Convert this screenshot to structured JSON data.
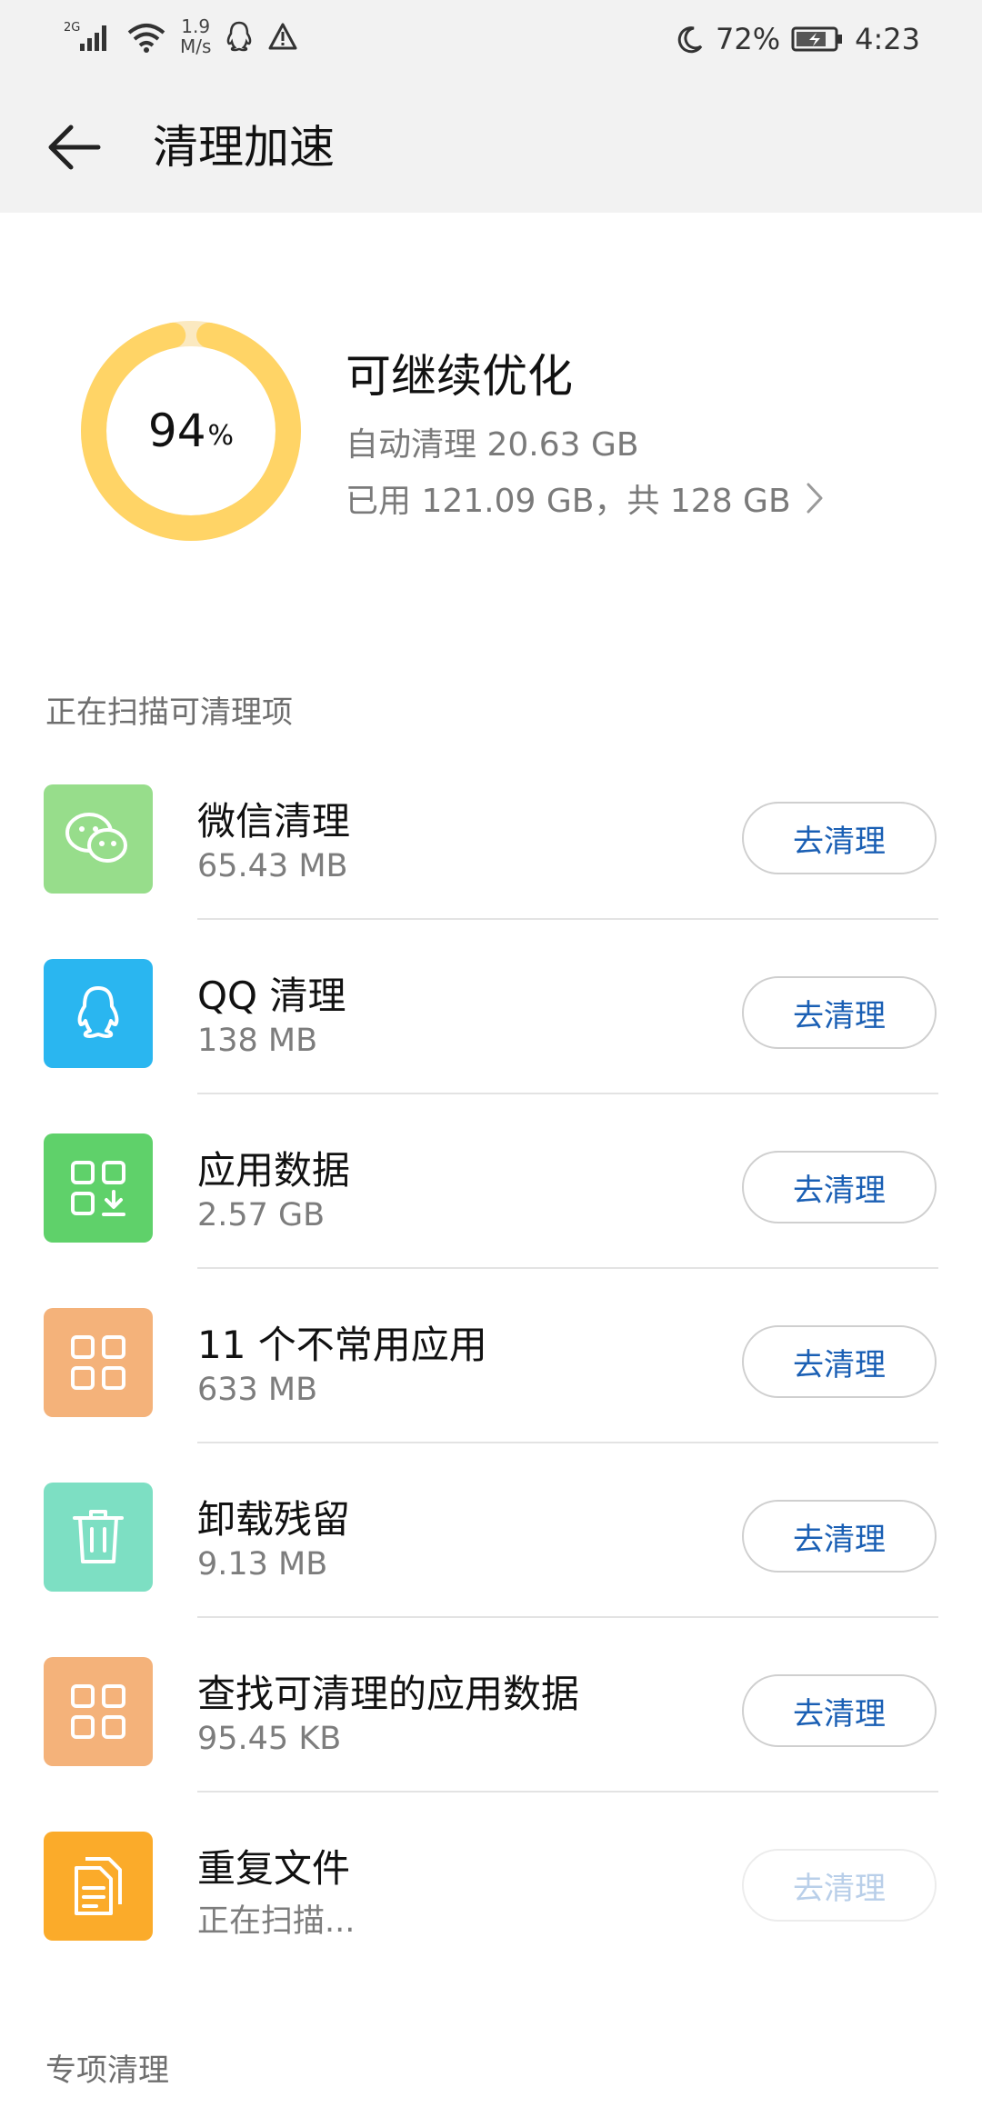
{
  "status_bar": {
    "network_type": "2G",
    "net_speed_value": "1.9",
    "net_speed_unit": "M/s",
    "battery_percent": "72%",
    "time": "4:23"
  },
  "header": {
    "title": "清理加速"
  },
  "summary": {
    "percent_value": "94",
    "percent_symbol": "%",
    "percent_level": 0.94,
    "title": "可继续优化",
    "auto_clean_text": "自动清理 20.63 GB",
    "storage_text": "已用 121.09 GB，共 128 GB",
    "ring_color": "#ffd466"
  },
  "sections": {
    "scanning_header": "正在扫描可清理项",
    "special_header": "专项清理"
  },
  "items": [
    {
      "title": "微信清理",
      "subtitle": "65.43 MB",
      "button": "去清理",
      "icon": "wechat-icon",
      "color": "#97dd8b",
      "enabled": true
    },
    {
      "title": "QQ 清理",
      "subtitle": "138 MB",
      "button": "去清理",
      "icon": "qq-icon",
      "color": "#2ab6f0",
      "enabled": true
    },
    {
      "title": "应用数据",
      "subtitle": "2.57 GB",
      "button": "去清理",
      "icon": "app-data-icon",
      "color": "#5fd16a",
      "enabled": true
    },
    {
      "title": "11 个不常用应用",
      "subtitle": "633 MB",
      "button": "去清理",
      "icon": "apps-grid-icon",
      "color": "#f4b27a",
      "enabled": true
    },
    {
      "title": "卸载残留",
      "subtitle": "9.13 MB",
      "button": "去清理",
      "icon": "trash-icon",
      "color": "#7ddfc3",
      "enabled": true
    },
    {
      "title": "查找可清理的应用数据",
      "subtitle": "95.45 KB",
      "button": "去清理",
      "icon": "apps-grid-icon",
      "color": "#f4b27a",
      "enabled": true
    },
    {
      "title": "重复文件",
      "subtitle": "正在扫描...",
      "button": "去清理",
      "icon": "duplicate-files-icon",
      "color": "#fbab2a",
      "enabled": false
    }
  ]
}
